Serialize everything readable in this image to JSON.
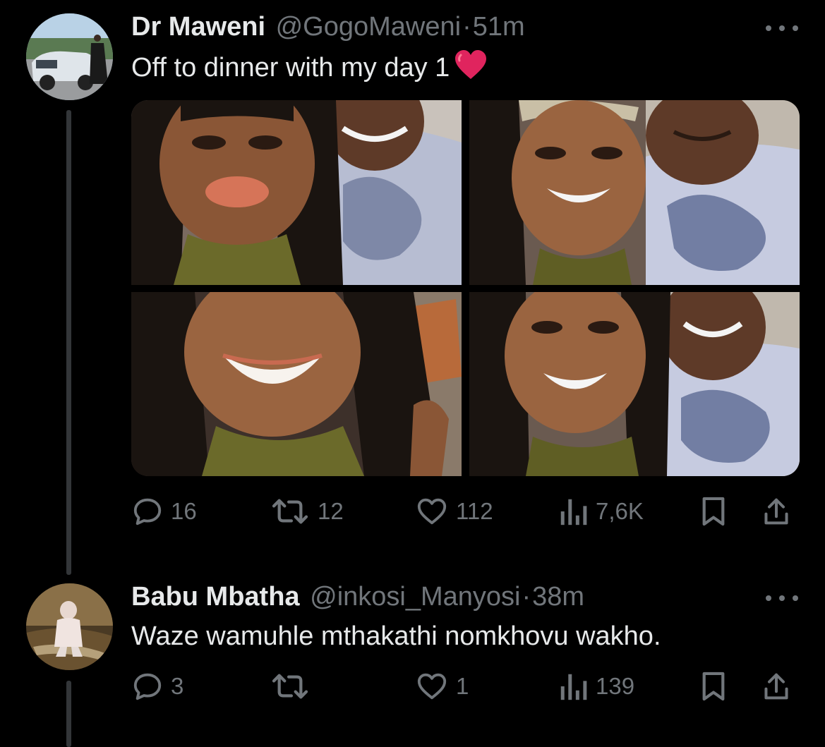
{
  "tweets": [
    {
      "author_name": "Dr Maweni",
      "handle": "@GogoMaweni",
      "separator": "·",
      "time": "51m",
      "text": "Off to dinner with my day 1",
      "emoji": "red-heart",
      "media_count": 4,
      "actions": {
        "replies": "16",
        "retweets": "12",
        "likes": "112",
        "views": "7,6K"
      }
    },
    {
      "author_name": "Babu Mbatha",
      "handle": "@inkosi_Manyosi",
      "separator": "·",
      "time": "38m",
      "text": "Waze wamuhle mthakathi nomkhovu wakho.",
      "actions": {
        "replies": "3",
        "retweets": "",
        "likes": "1",
        "views": "139"
      }
    }
  ],
  "colors": {
    "background": "#000000",
    "primary_text": "#e7e9ea",
    "secondary_text": "#71767b",
    "thread_line": "#333639",
    "heart": "#e0245e"
  },
  "icons": {
    "reply": "reply-icon",
    "retweet": "retweet-icon",
    "like": "like-icon",
    "views": "views-icon",
    "bookmark": "bookmark-icon",
    "share": "share-icon",
    "more": "more-icon"
  }
}
